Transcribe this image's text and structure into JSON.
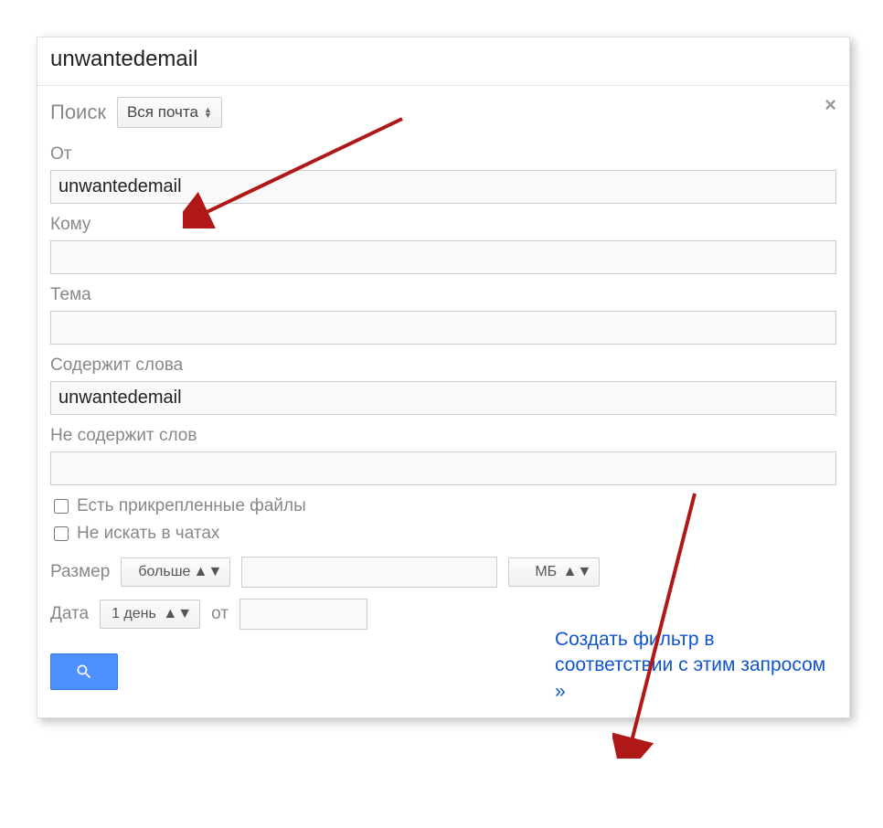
{
  "header": {
    "title": "unwantedemail"
  },
  "close_icon": "×",
  "search": {
    "label": "Поиск",
    "scope_selected": "Вся почта"
  },
  "fields": {
    "from": {
      "label": "От",
      "value": "unwantedemail"
    },
    "to": {
      "label": "Кому",
      "value": ""
    },
    "subject": {
      "label": "Тема",
      "value": ""
    },
    "has_words": {
      "label": "Содержит слова",
      "value": "unwantedemail"
    },
    "not_words": {
      "label": "Не содержит слов",
      "value": ""
    }
  },
  "checks": {
    "attachments": "Есть прикрепленные файлы",
    "no_chats": "Не искать в чатах"
  },
  "size": {
    "label": "Размер",
    "op_selected": "больше",
    "value": "",
    "unit_selected": "МБ"
  },
  "date": {
    "label": "Дата",
    "range_selected": "1 день",
    "from_label": "от",
    "from_value": ""
  },
  "create_filter_link": "Создать фильтр в соответствии с этим запросом »"
}
